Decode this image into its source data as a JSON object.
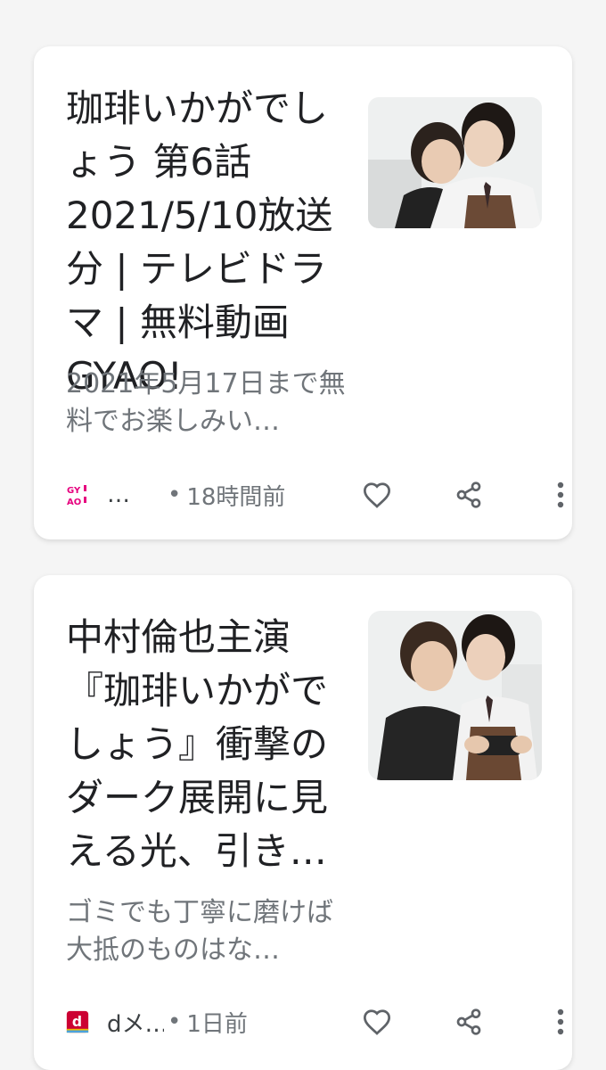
{
  "articles": [
    {
      "title": "珈琲いかがでしょう 第6話 2021/5/10放送分 | テレビドラマ | 無料動画GYAO!",
      "snippet": "2021年5月17日まで無料でお楽しみい…",
      "source_logo_text": "GY! AO!",
      "source_name": "…",
      "separator": "•",
      "time": "18時間前",
      "icons": [
        "gyao-logo-icon",
        "heart-icon",
        "share-icon",
        "more-vert-icon"
      ]
    },
    {
      "title": "中村倫也主演『珈琲いかがでしょう』衝撃のダーク展開に見える光、引き…",
      "snippet": "ゴミでも丁寧に磨けば大抵のものはな…",
      "source_logo_text": "d",
      "source_name": "dメ…",
      "separator": "•",
      "time": "1日前",
      "icons": [
        "dmenu-logo-icon",
        "heart-icon",
        "share-icon",
        "more-vert-icon"
      ]
    }
  ],
  "colors": {
    "background": "#f5f5f5",
    "card": "#ffffff",
    "title": "#202124",
    "secondary": "#70757a",
    "icon": "#5f6368",
    "gyao_pink": "#e6007e",
    "dmenu_red": "#cc0033"
  }
}
